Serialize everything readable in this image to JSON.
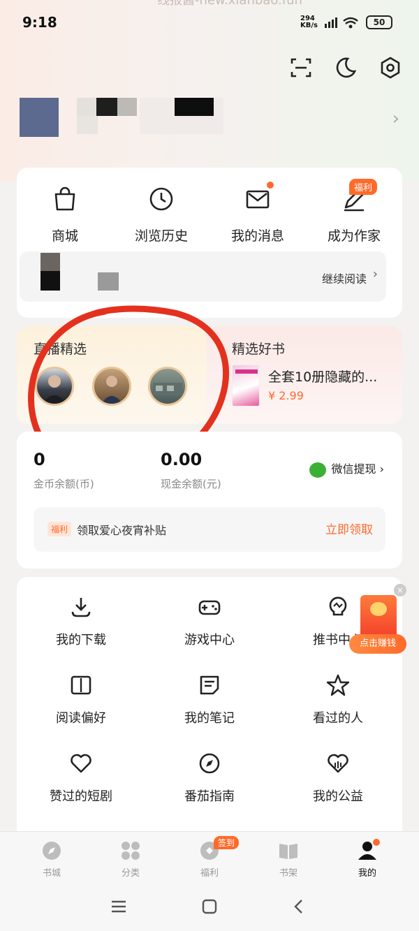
{
  "status_bar": {
    "time": "9:18",
    "watermark": "线报酱-new.xianbao.fun",
    "net_speed_value": "294",
    "net_speed_unit": "KB/s",
    "battery": "50"
  },
  "header": {
    "icons": [
      "scan-icon",
      "moon-icon",
      "settings-icon"
    ]
  },
  "quick_actions": [
    {
      "label": "商城",
      "icon": "shopping-bag-icon"
    },
    {
      "label": "浏览历史",
      "icon": "clock-icon"
    },
    {
      "label": "我的消息",
      "icon": "mail-icon"
    },
    {
      "label": "成为作家",
      "icon": "pen-icon",
      "badge": "福利"
    }
  ],
  "continue_reading": {
    "label": "继续阅读"
  },
  "live": {
    "title": "直播精选"
  },
  "books": {
    "title": "精选好书",
    "book_title": "全套10册隐藏的...",
    "price": "¥ 2.99"
  },
  "wallet": {
    "coins": "0",
    "coins_label": "金币余额(币)",
    "cash": "0.00",
    "cash_label": "现金余额(元)",
    "wechat_withdraw": "微信提现",
    "bonus_tag": "福利",
    "bonus_text": "领取爱心夜宵补贴",
    "bonus_cta": "立即领取"
  },
  "grid": [
    {
      "label": "我的下载",
      "icon": "download-icon"
    },
    {
      "label": "游戏中心",
      "icon": "gamepad-icon"
    },
    {
      "label": "推书中心",
      "icon": "bulb-icon"
    },
    {
      "label": "阅读偏好",
      "icon": "book-icon"
    },
    {
      "label": "我的笔记",
      "icon": "note-icon"
    },
    {
      "label": "看过的人",
      "icon": "star-icon"
    },
    {
      "label": "赞过的短剧",
      "icon": "heart-icon"
    },
    {
      "label": "番茄指南",
      "icon": "compass-icon"
    },
    {
      "label": "我的公益",
      "icon": "charity-heart-icon"
    }
  ],
  "red_packet": {
    "label": "点击赚钱"
  },
  "tabbar": [
    {
      "label": "书城",
      "icon": "bookstore-icon"
    },
    {
      "label": "分类",
      "icon": "category-icon"
    },
    {
      "label": "福利",
      "icon": "welfare-icon",
      "badge": "签到"
    },
    {
      "label": "书架",
      "icon": "bookshelf-icon"
    },
    {
      "label": "我的",
      "icon": "person-icon",
      "active": true
    }
  ],
  "colors": {
    "accent": "#ff6a2b",
    "wechat_green": "#3cb035",
    "annotation_red": "#e3311d"
  }
}
